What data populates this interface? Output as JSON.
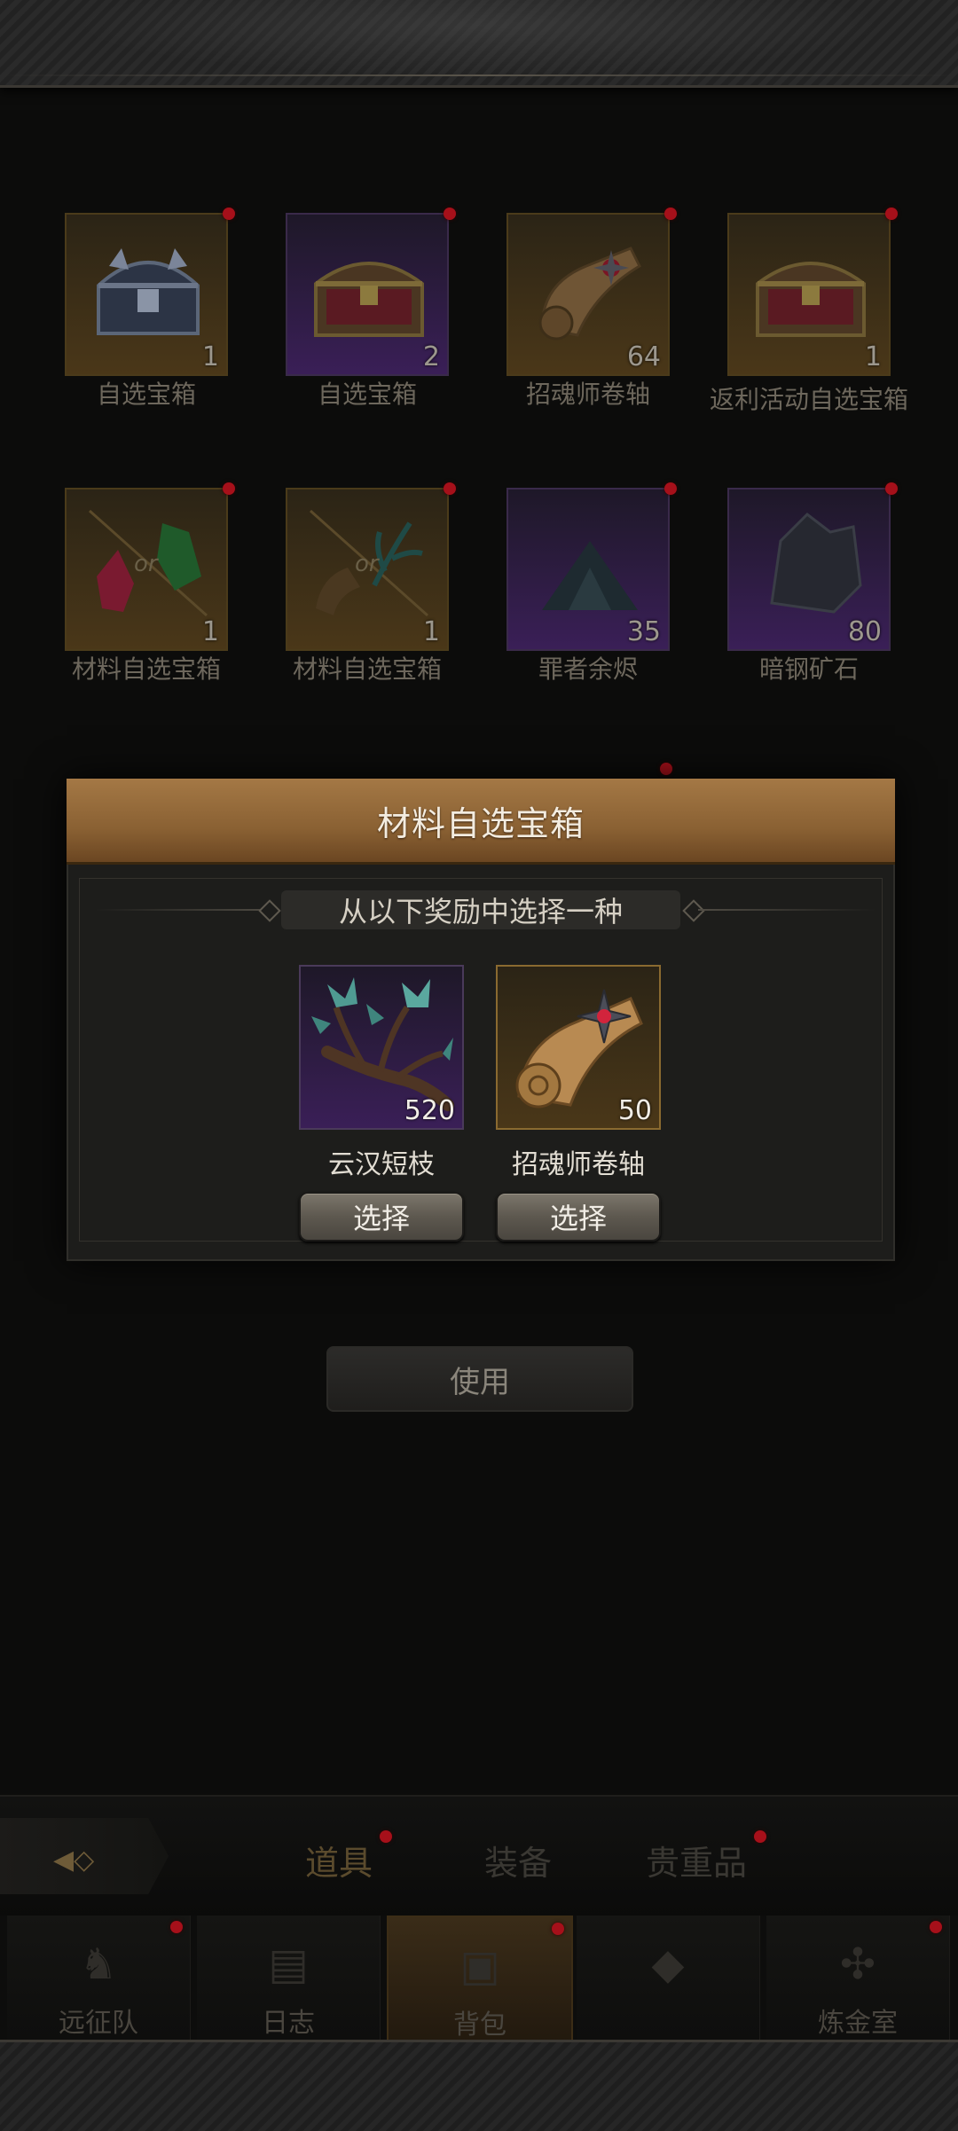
{
  "inventory": {
    "items": [
      {
        "name": "自选宝箱",
        "count": "1",
        "rarity": "gold",
        "icon": "steel-chest-icon"
      },
      {
        "name": "自选宝箱",
        "count": "2",
        "rarity": "purple",
        "icon": "wooden-chest-icon"
      },
      {
        "name": "招魂师卷轴",
        "count": "64",
        "rarity": "gold",
        "icon": "scroll-icon"
      },
      {
        "name": "返利活动自选宝箱",
        "count": "1",
        "rarity": "gold",
        "icon": "wooden-chest-icon"
      },
      {
        "name": "材料自选宝箱",
        "count": "1",
        "rarity": "gold",
        "icon": "crystal-choice-icon"
      },
      {
        "name": "材料自选宝箱",
        "count": "1",
        "rarity": "gold",
        "icon": "scroll-branch-choice-icon"
      },
      {
        "name": "罪者余烬",
        "count": "35",
        "rarity": "purple",
        "icon": "ember-pile-icon"
      },
      {
        "name": "暗钢矿石",
        "count": "80",
        "rarity": "purple",
        "icon": "dark-ore-icon"
      }
    ]
  },
  "modal": {
    "title": "材料自选宝箱",
    "prompt": "从以下奖励中选择一种",
    "rewards": [
      {
        "name": "云汉短枝",
        "count": "520",
        "rarity": "purple",
        "icon": "crystal-branch-icon",
        "button": "选择"
      },
      {
        "name": "招魂师卷轴",
        "count": "50",
        "rarity": "gold",
        "icon": "scroll-icon",
        "button": "选择"
      }
    ]
  },
  "use_button": "使用",
  "tabs": [
    {
      "label": "道具",
      "active": true
    },
    {
      "label": "装备",
      "active": false
    },
    {
      "label": "贵重品",
      "active": false
    }
  ],
  "or_text": "or",
  "nav": [
    {
      "label": "远征队",
      "icon": "horned-helmet-icon"
    },
    {
      "label": "日志",
      "icon": "map-scroll-icon"
    },
    {
      "label": "背包",
      "icon": "backpack-icon",
      "active": true
    },
    {
      "label": "",
      "icon": "unknown-icon"
    },
    {
      "label": "炼金室",
      "icon": "alchemy-icon"
    }
  ],
  "colors": {
    "header_gold": "#a47845",
    "badge_red": "#a6101a",
    "rarity_purple": "#3a1f57",
    "rarity_gold": "#4a3718"
  }
}
